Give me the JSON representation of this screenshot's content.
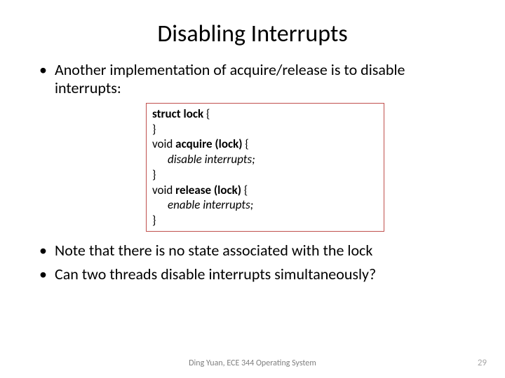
{
  "title": "Disabling Interrupts",
  "bullets": {
    "b1": "Another implementation of acquire/release is to disable interrupts:",
    "b2": "Note that there is no state associated with the lock",
    "b3": "Can two threads disable interrupts simultaneously?"
  },
  "code": {
    "l1a": "struct ",
    "l1b": "lock",
    "l1c": " {",
    "l2": "}",
    "l3a": "void ",
    "l3b": "acquire (lock)",
    "l3c": " {",
    "l4": "disable interrupts;",
    "l5": "}",
    "l6a": "void ",
    "l6b": "release (lock)",
    "l6c": " {",
    "l7": "enable interrupts;",
    "l8": "}"
  },
  "footer": {
    "center": "Ding Yuan, ECE 344 Operating System",
    "page": "29"
  }
}
